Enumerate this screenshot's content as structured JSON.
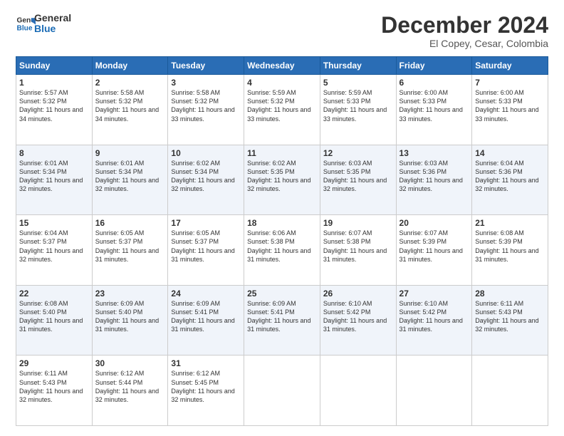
{
  "logo": {
    "line1": "General",
    "line2": "Blue"
  },
  "title": "December 2024",
  "subtitle": "El Copey, Cesar, Colombia",
  "days": [
    "Sunday",
    "Monday",
    "Tuesday",
    "Wednesday",
    "Thursday",
    "Friday",
    "Saturday"
  ],
  "weeks": [
    [
      {
        "day": "1",
        "sunrise": "5:57 AM",
        "sunset": "5:32 PM",
        "daylight": "11 hours and 34 minutes."
      },
      {
        "day": "2",
        "sunrise": "5:58 AM",
        "sunset": "5:32 PM",
        "daylight": "11 hours and 34 minutes."
      },
      {
        "day": "3",
        "sunrise": "5:58 AM",
        "sunset": "5:32 PM",
        "daylight": "11 hours and 33 minutes."
      },
      {
        "day": "4",
        "sunrise": "5:59 AM",
        "sunset": "5:32 PM",
        "daylight": "11 hours and 33 minutes."
      },
      {
        "day": "5",
        "sunrise": "5:59 AM",
        "sunset": "5:33 PM",
        "daylight": "11 hours and 33 minutes."
      },
      {
        "day": "6",
        "sunrise": "6:00 AM",
        "sunset": "5:33 PM",
        "daylight": "11 hours and 33 minutes."
      },
      {
        "day": "7",
        "sunrise": "6:00 AM",
        "sunset": "5:33 PM",
        "daylight": "11 hours and 33 minutes."
      }
    ],
    [
      {
        "day": "8",
        "sunrise": "6:01 AM",
        "sunset": "5:34 PM",
        "daylight": "11 hours and 32 minutes."
      },
      {
        "day": "9",
        "sunrise": "6:01 AM",
        "sunset": "5:34 PM",
        "daylight": "11 hours and 32 minutes."
      },
      {
        "day": "10",
        "sunrise": "6:02 AM",
        "sunset": "5:34 PM",
        "daylight": "11 hours and 32 minutes."
      },
      {
        "day": "11",
        "sunrise": "6:02 AM",
        "sunset": "5:35 PM",
        "daylight": "11 hours and 32 minutes."
      },
      {
        "day": "12",
        "sunrise": "6:03 AM",
        "sunset": "5:35 PM",
        "daylight": "11 hours and 32 minutes."
      },
      {
        "day": "13",
        "sunrise": "6:03 AM",
        "sunset": "5:36 PM",
        "daylight": "11 hours and 32 minutes."
      },
      {
        "day": "14",
        "sunrise": "6:04 AM",
        "sunset": "5:36 PM",
        "daylight": "11 hours and 32 minutes."
      }
    ],
    [
      {
        "day": "15",
        "sunrise": "6:04 AM",
        "sunset": "5:37 PM",
        "daylight": "11 hours and 32 minutes."
      },
      {
        "day": "16",
        "sunrise": "6:05 AM",
        "sunset": "5:37 PM",
        "daylight": "11 hours and 31 minutes."
      },
      {
        "day": "17",
        "sunrise": "6:05 AM",
        "sunset": "5:37 PM",
        "daylight": "11 hours and 31 minutes."
      },
      {
        "day": "18",
        "sunrise": "6:06 AM",
        "sunset": "5:38 PM",
        "daylight": "11 hours and 31 minutes."
      },
      {
        "day": "19",
        "sunrise": "6:07 AM",
        "sunset": "5:38 PM",
        "daylight": "11 hours and 31 minutes."
      },
      {
        "day": "20",
        "sunrise": "6:07 AM",
        "sunset": "5:39 PM",
        "daylight": "11 hours and 31 minutes."
      },
      {
        "day": "21",
        "sunrise": "6:08 AM",
        "sunset": "5:39 PM",
        "daylight": "11 hours and 31 minutes."
      }
    ],
    [
      {
        "day": "22",
        "sunrise": "6:08 AM",
        "sunset": "5:40 PM",
        "daylight": "11 hours and 31 minutes."
      },
      {
        "day": "23",
        "sunrise": "6:09 AM",
        "sunset": "5:40 PM",
        "daylight": "11 hours and 31 minutes."
      },
      {
        "day": "24",
        "sunrise": "6:09 AM",
        "sunset": "5:41 PM",
        "daylight": "11 hours and 31 minutes."
      },
      {
        "day": "25",
        "sunrise": "6:09 AM",
        "sunset": "5:41 PM",
        "daylight": "11 hours and 31 minutes."
      },
      {
        "day": "26",
        "sunrise": "6:10 AM",
        "sunset": "5:42 PM",
        "daylight": "11 hours and 31 minutes."
      },
      {
        "day": "27",
        "sunrise": "6:10 AM",
        "sunset": "5:42 PM",
        "daylight": "11 hours and 31 minutes."
      },
      {
        "day": "28",
        "sunrise": "6:11 AM",
        "sunset": "5:43 PM",
        "daylight": "11 hours and 32 minutes."
      }
    ],
    [
      {
        "day": "29",
        "sunrise": "6:11 AM",
        "sunset": "5:43 PM",
        "daylight": "11 hours and 32 minutes."
      },
      {
        "day": "30",
        "sunrise": "6:12 AM",
        "sunset": "5:44 PM",
        "daylight": "11 hours and 32 minutes."
      },
      {
        "day": "31",
        "sunrise": "6:12 AM",
        "sunset": "5:45 PM",
        "daylight": "11 hours and 32 minutes."
      },
      null,
      null,
      null,
      null
    ]
  ],
  "labels": {
    "sunrise": "Sunrise:",
    "sunset": "Sunset:",
    "daylight": "Daylight: "
  }
}
